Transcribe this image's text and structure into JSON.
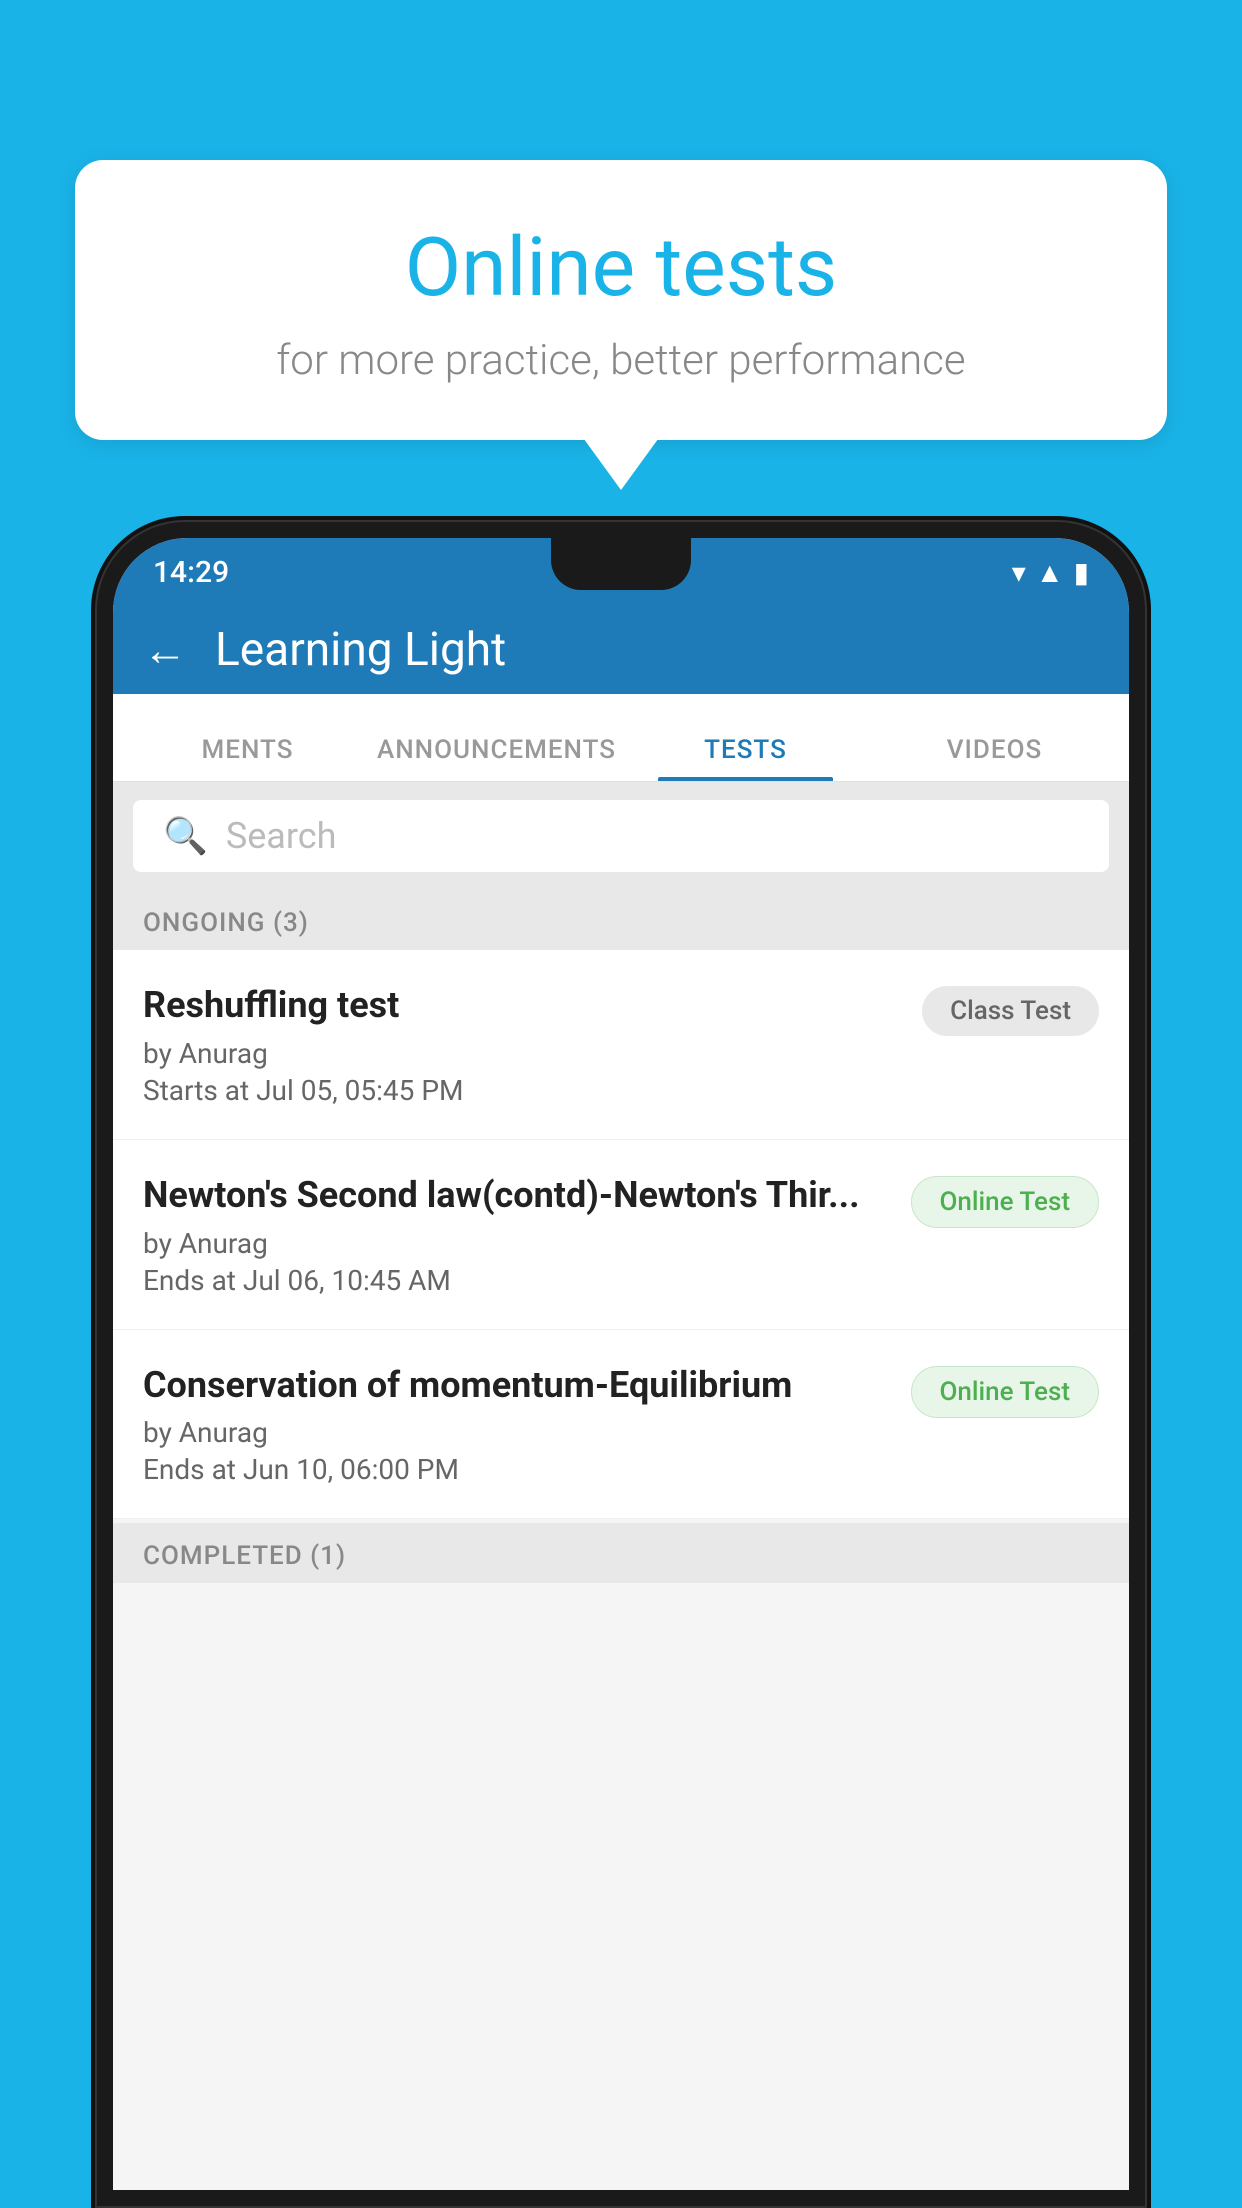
{
  "background_color": "#1ab3e8",
  "speech_bubble": {
    "title": "Online tests",
    "subtitle": "for more practice, better performance"
  },
  "phone": {
    "status_bar": {
      "time": "14:29",
      "icons": [
        "wifi",
        "signal",
        "battery"
      ]
    },
    "app_header": {
      "back_label": "←",
      "title": "Learning Light"
    },
    "tabs": [
      {
        "label": "MENTS",
        "active": false
      },
      {
        "label": "ANNOUNCEMENTS",
        "active": false
      },
      {
        "label": "TESTS",
        "active": true
      },
      {
        "label": "VIDEOS",
        "active": false
      }
    ],
    "search": {
      "placeholder": "Search",
      "icon": "🔍"
    },
    "ongoing_section": {
      "label": "ONGOING (3)",
      "tests": [
        {
          "name": "Reshuffling test",
          "by": "by Anurag",
          "time": "Starts at  Jul 05, 05:45 PM",
          "badge": "Class Test",
          "badge_type": "class"
        },
        {
          "name": "Newton's Second law(contd)-Newton's Thir...",
          "by": "by Anurag",
          "time": "Ends at  Jul 06, 10:45 AM",
          "badge": "Online Test",
          "badge_type": "online"
        },
        {
          "name": "Conservation of momentum-Equilibrium",
          "by": "by Anurag",
          "time": "Ends at  Jun 10, 06:00 PM",
          "badge": "Online Test",
          "badge_type": "online"
        }
      ]
    },
    "completed_section": {
      "label": "COMPLETED (1)"
    }
  }
}
